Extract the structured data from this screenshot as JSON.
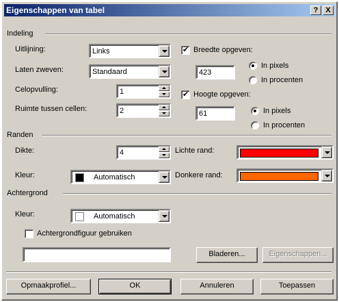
{
  "window": {
    "title": "Eigenschappen van tabel",
    "help_button": "?",
    "close_button": "X"
  },
  "layout_group": {
    "title": "Indeling",
    "alignment": {
      "label": "Uitlijning:",
      "value": "Links"
    },
    "float": {
      "label": "Laten zweven:",
      "value": "Standaard"
    },
    "cell_padding": {
      "label": "Celopvulling:",
      "value": "1"
    },
    "cell_spacing": {
      "label": "Ruimte tussen cellen:",
      "value": "2"
    },
    "width": {
      "checkbox_label": "Breedte opgeven:",
      "checked": true,
      "value": "423",
      "unit_pixels": "In pixels",
      "unit_percent": "In procenten",
      "selected": "In pixels"
    },
    "height": {
      "checkbox_label": "Hoogte opgeven:",
      "checked": true,
      "value": "61",
      "unit_pixels": "In pixels",
      "unit_percent": "In procenten",
      "selected": "In pixels"
    }
  },
  "borders_group": {
    "title": "Randen",
    "thickness": {
      "label": "Dikte:",
      "value": "4"
    },
    "light_border": {
      "label": "Lichte rand:",
      "color": "#ff0000"
    },
    "color": {
      "label": "Kleur:",
      "value": "Automatisch",
      "swatch": "#000000"
    },
    "dark_border": {
      "label": "Donkere rand:",
      "color": "#ff6600"
    }
  },
  "background_group": {
    "title": "Achtergrond",
    "color": {
      "label": "Kleur:",
      "value": "Automatisch",
      "swatch": "#ffffff"
    },
    "use_image": {
      "label": "Achtergrondfiguur gebruiken",
      "checked": false
    },
    "image_path": "",
    "browse_button": "Bladeren...",
    "properties_button": "Eigenschappen..."
  },
  "footer": {
    "style_button": "Opmaakprofiel...",
    "ok_button": "OK",
    "cancel_button": "Annuleren",
    "apply_button": "Toepassen"
  }
}
